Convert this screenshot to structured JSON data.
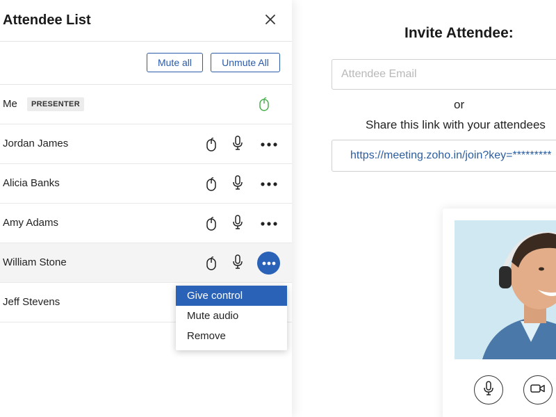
{
  "attendee_panel": {
    "title": "Attendee List",
    "mute_all_label": "Mute all",
    "unmute_all_label": "Unmute All",
    "me": {
      "name": "Me",
      "badge": "PRESENTER",
      "mouse_icon_color": "#4caf50"
    },
    "attendees": [
      {
        "name": "Jordan James"
      },
      {
        "name": "Alicia Banks"
      },
      {
        "name": "Amy Adams"
      },
      {
        "name": "William Stone"
      },
      {
        "name": "Jeff Stevens"
      }
    ],
    "context_menu": {
      "items": [
        "Give control",
        "Mute audio",
        "Remove"
      ],
      "selected": "Give control"
    }
  },
  "invite": {
    "title": "Invite Attendee:",
    "email_placeholder": "Attendee Email",
    "or_text": "or",
    "share_text": "Share this link with your attendees",
    "link": "https://meeting.zoho.in/join?key=*********"
  },
  "colors": {
    "accent": "#2a62b8",
    "link": "#2a5d9f",
    "presenter_mouse": "#4caf50"
  },
  "icons": [
    "close-icon",
    "mouse-icon",
    "mic-icon",
    "more-icon",
    "camera-icon"
  ]
}
